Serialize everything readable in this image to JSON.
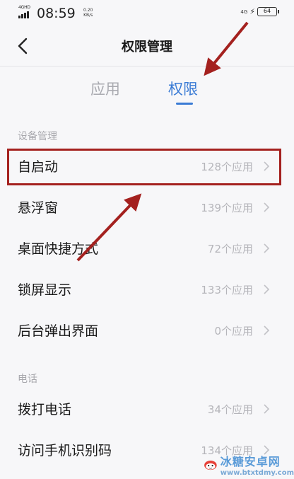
{
  "status_bar": {
    "network": "4GHD",
    "time": "08:59",
    "speed_value": "0.20",
    "speed_unit": "KB/s",
    "lte": "4G",
    "battery": "64"
  },
  "header": {
    "title": "权限管理"
  },
  "tabs": [
    {
      "label": "应用",
      "active": false
    },
    {
      "label": "权限",
      "active": true
    }
  ],
  "sections": [
    {
      "title": "设备管理",
      "items": [
        {
          "label": "自启动",
          "count": "128个应用"
        },
        {
          "label": "悬浮窗",
          "count": "139个应用"
        },
        {
          "label": "桌面快捷方式",
          "count": "72个应用"
        },
        {
          "label": "锁屏显示",
          "count": "133个应用"
        },
        {
          "label": "后台弹出界面",
          "count": "0个应用"
        }
      ]
    },
    {
      "title": "电话",
      "items": [
        {
          "label": "拨打电话",
          "count": "34个应用"
        },
        {
          "label": "访问手机识别码",
          "count": "134个应用"
        }
      ]
    }
  ],
  "watermark": {
    "name": "冰糖安卓网",
    "url": "www.btxtdmy.com"
  },
  "colors": {
    "accent": "#3a7bd5",
    "annotation": "#a4211f",
    "muted": "#b5b5ba"
  }
}
